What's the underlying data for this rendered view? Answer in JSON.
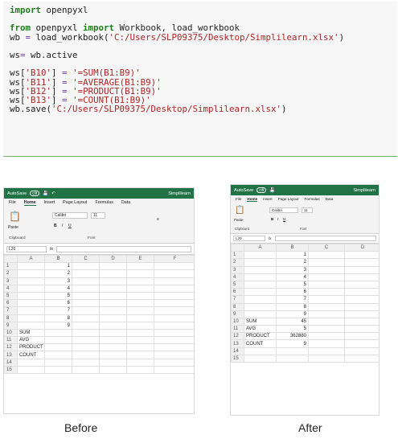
{
  "code": {
    "l1_kw": "import",
    "l1_rest": " openpyxl",
    "l2_kw1": "from",
    "l2_mid": " openpyxl ",
    "l2_kw2": "import",
    "l2_rest": " Workbook, load_workbook",
    "l3_a": "wb ",
    "l3_eq": "=",
    "l3_b": " load_workbook(",
    "l3_str": "'C:/Users/SLP09375/Desktop/Simplilearn.xlsx'",
    "l3_c": ")",
    "l4_a": "ws",
    "l4_eq": "=",
    "l4_b": " wb.active",
    "lines": [
      {
        "a": "ws[",
        "k": "'B10'",
        "b": "] ",
        "eq": "=",
        "v": " '=SUM(B1:B9)'"
      },
      {
        "a": "ws[",
        "k": "'B11'",
        "b": "] ",
        "eq": "=",
        "v": " '=AVERAGE(B1:B9)'"
      },
      {
        "a": "ws[",
        "k": "'B12'",
        "b": "] ",
        "eq": "=",
        "v": " '=PRODUCT(B1:B9)'"
      },
      {
        "a": "ws[",
        "k": "'B13'",
        "b": "] ",
        "eq": "=",
        "v": " '=COUNT(B1:B9)'"
      }
    ],
    "save_a": "wb.save(",
    "save_str": "'C:/Users/SLP09375/Desktop/Simplilearn.xlsx'",
    "save_b": ")"
  },
  "before": {
    "autosave": "AutoSave",
    "toggle": "Off",
    "title": "Simplilearn",
    "tabs": [
      "File",
      "Home",
      "Insert",
      "Page Layout",
      "Formulas",
      "Data"
    ],
    "font": "Calibri",
    "size": "11",
    "paste": "Paste",
    "clipboard": "Clipboard",
    "font_group": "Font",
    "namebox": "L20",
    "fx": "fx",
    "cols": [
      "A",
      "B",
      "C",
      "D",
      "E",
      "F"
    ],
    "rows": [
      {
        "r": "1",
        "a": "",
        "b": "1"
      },
      {
        "r": "2",
        "a": "",
        "b": "2"
      },
      {
        "r": "3",
        "a": "",
        "b": "3"
      },
      {
        "r": "4",
        "a": "",
        "b": "4"
      },
      {
        "r": "5",
        "a": "",
        "b": "5"
      },
      {
        "r": "6",
        "a": "",
        "b": "6"
      },
      {
        "r": "7",
        "a": "",
        "b": "7"
      },
      {
        "r": "8",
        "a": "",
        "b": "8"
      },
      {
        "r": "9",
        "a": "",
        "b": "9"
      },
      {
        "r": "10",
        "a": "SUM",
        "b": ""
      },
      {
        "r": "11",
        "a": "AVG",
        "b": ""
      },
      {
        "r": "12",
        "a": "PRODUCT",
        "b": ""
      },
      {
        "r": "13",
        "a": "COUNT",
        "b": ""
      },
      {
        "r": "14",
        "a": "",
        "b": ""
      },
      {
        "r": "15",
        "a": "",
        "b": ""
      }
    ]
  },
  "after": {
    "autosave": "AutoSave",
    "toggle": "Off",
    "title": "Simplilearn",
    "tabs": [
      "File",
      "Home",
      "Insert",
      "Page Layout",
      "Formulas",
      "Data"
    ],
    "font": "Calibri",
    "size": "11",
    "paste": "Paste",
    "clipboard": "Clipboard",
    "font_group": "Font",
    "namebox": "L20",
    "fx": "fx",
    "cols": [
      "A",
      "B",
      "C",
      "D"
    ],
    "rows": [
      {
        "r": "1",
        "a": "",
        "b": "1"
      },
      {
        "r": "2",
        "a": "",
        "b": "2"
      },
      {
        "r": "3",
        "a": "",
        "b": "3"
      },
      {
        "r": "4",
        "a": "",
        "b": "4"
      },
      {
        "r": "5",
        "a": "",
        "b": "5"
      },
      {
        "r": "6",
        "a": "",
        "b": "6"
      },
      {
        "r": "7",
        "a": "",
        "b": "7"
      },
      {
        "r": "8",
        "a": "",
        "b": "8"
      },
      {
        "r": "9",
        "a": "",
        "b": "9"
      },
      {
        "r": "10",
        "a": "SUM",
        "b": "45"
      },
      {
        "r": "11",
        "a": "AVG",
        "b": "5"
      },
      {
        "r": "12",
        "a": "PRODUCT",
        "b": "362880"
      },
      {
        "r": "13",
        "a": "COUNT",
        "b": "9"
      },
      {
        "r": "14",
        "a": "",
        "b": ""
      },
      {
        "r": "15",
        "a": "",
        "b": ""
      }
    ]
  },
  "captions": {
    "before": "Before",
    "after": "After"
  }
}
